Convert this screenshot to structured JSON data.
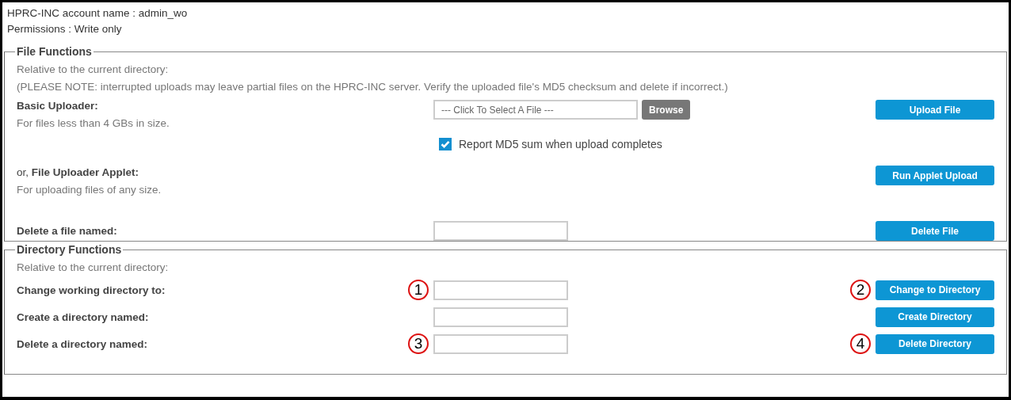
{
  "account": {
    "name_line": "HPRC-INC account name : admin_wo",
    "permissions_line": "Permissions : Write only"
  },
  "file_functions": {
    "legend": "File Functions",
    "intro": "Relative to the current directory:",
    "note": "(PLEASE NOTE: interrupted uploads may leave partial files on the HPRC-INC server. Verify the uploaded file's MD5 checksum and delete if incorrect.)",
    "basic_uploader": {
      "label": "Basic Uploader:",
      "hint": "For files less than 4 GBs in size.",
      "file_field": {
        "placeholder": "--- Click To Select A File ---"
      },
      "browse_button": "Browse",
      "button": "Upload File"
    },
    "md5_option": {
      "label": "Report MD5 sum when upload completes",
      "checked": true
    },
    "applet": {
      "prefix": "or, ",
      "label": "File Uploader Applet:",
      "hint": "For uploading files of any size.",
      "button": "Run Applet Upload"
    },
    "delete_file": {
      "label": "Delete a file named:",
      "button": "Delete File"
    }
  },
  "directory_functions": {
    "legend": "Directory Functions",
    "intro": "Relative to the current directory:",
    "rows": [
      {
        "label": "Change working directory to:",
        "field_marker": "1",
        "button": "Change to Directory",
        "button_marker": "2"
      },
      {
        "label": "Create a directory named:",
        "button": "Create Directory"
      },
      {
        "label": "Delete a directory named:",
        "field_marker": "3",
        "button": "Delete Directory",
        "button_marker": "4"
      }
    ]
  }
}
